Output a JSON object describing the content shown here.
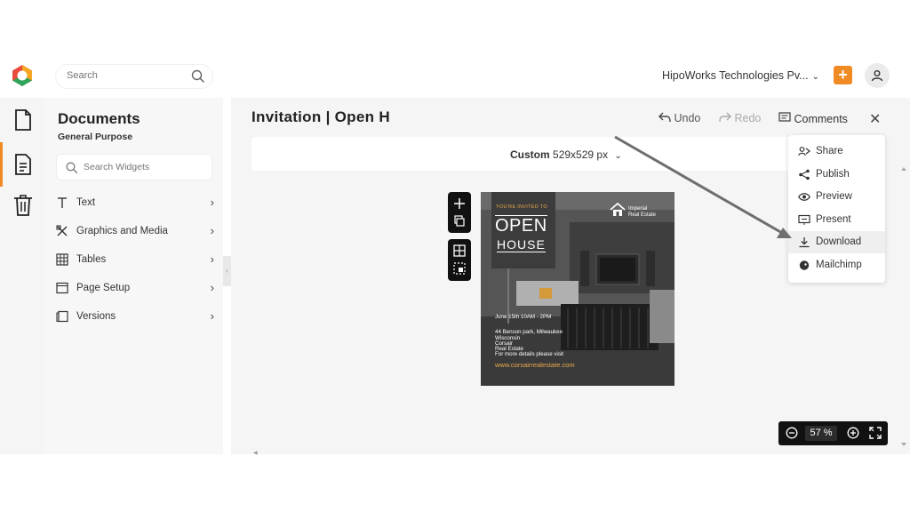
{
  "header": {
    "search_placeholder": "Search",
    "org_name": "HipoWorks Technologies Pv...",
    "add_label": "+"
  },
  "sidebar_panel": {
    "title": "Documents",
    "subtitle": "General Purpose",
    "widget_search_placeholder": "Search Widgets",
    "items": [
      {
        "label": "Text",
        "icon": "text-icon"
      },
      {
        "label": "Graphics and Media",
        "icon": "graphics-icon"
      },
      {
        "label": "Tables",
        "icon": "table-icon"
      },
      {
        "label": "Page Setup",
        "icon": "page-setup-icon"
      },
      {
        "label": "Versions",
        "icon": "versions-icon"
      }
    ]
  },
  "document": {
    "title": "Invitation | Open H",
    "undo_label": "Undo",
    "redo_label": "Redo",
    "comments_label": "Comments",
    "size_preset": "Custom",
    "size_value": "529x529 px"
  },
  "canvas": {
    "invited": "YOU'RE INVITED TO",
    "open": "OPEN",
    "house": "HOUSE",
    "brand_line1": "Imperial",
    "brand_line2": "Real Estate",
    "date": "June 15th 10AM - 2PM",
    "address1": "44 Benson park, Milwaukee",
    "address2": "Wisconsin",
    "company1": "Corsair",
    "company2": "Real Estate",
    "details": "For more details please visit",
    "url": "www.corsairrealestate.com"
  },
  "share_menu": {
    "items": [
      {
        "label": "Share",
        "icon": "share-users-icon"
      },
      {
        "label": "Publish",
        "icon": "publish-icon"
      },
      {
        "label": "Preview",
        "icon": "eye-icon"
      },
      {
        "label": "Present",
        "icon": "present-icon"
      },
      {
        "label": "Download",
        "icon": "download-icon"
      },
      {
        "label": "Mailchimp",
        "icon": "mailchimp-icon"
      }
    ]
  },
  "zoom": {
    "value": "57 %"
  },
  "colors": {
    "accent": "#f08a24",
    "canvas_bg": "#4a4a4a",
    "gold": "#e8a94a"
  }
}
